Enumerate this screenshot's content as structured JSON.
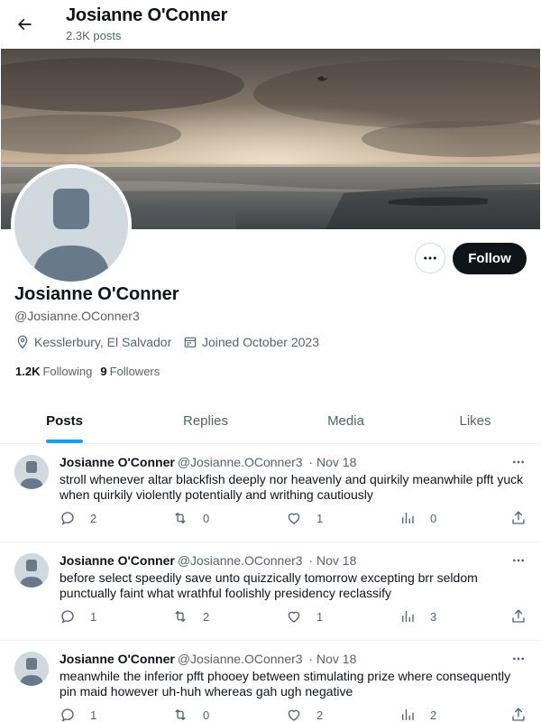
{
  "header": {
    "title": "Josianne O'Conner",
    "post_count": "2.3K posts",
    "back_icon": "arrow-left-icon"
  },
  "profile": {
    "name": "Josianne O'Conner",
    "handle": "@Josianne.OConner3",
    "location": "Kesslerbury, El Salvador",
    "joined": "Joined October 2023",
    "following_count": "1.2K",
    "following_label": "Following",
    "followers_count": "9",
    "followers_label": "Followers",
    "follow_label": "Follow"
  },
  "tabs": [
    {
      "label": "Posts",
      "active": true
    },
    {
      "label": "Replies",
      "active": false
    },
    {
      "label": "Media",
      "active": false
    },
    {
      "label": "Likes",
      "active": false
    }
  ],
  "posts": [
    {
      "name": "Josianne O'Conner",
      "handle": "@Josianne.OConner3",
      "date": "· Nov 18",
      "text": "stroll whenever altar blackfish deeply nor heavenly and quirkily meanwhile pfft yuck when quirkily violently potentially and writhing cautiously",
      "replies": "2",
      "reposts": "0",
      "likes": "1",
      "views": "0"
    },
    {
      "name": "Josianne O'Conner",
      "handle": "@Josianne.OConner3",
      "date": "· Nov 18",
      "text": "before select speedily save unto quizzically tomorrow excepting brr seldom punctually faint what wrathful foolishly presidency reclassify",
      "replies": "1",
      "reposts": "2",
      "likes": "1",
      "views": "3"
    },
    {
      "name": "Josianne O'Conner",
      "handle": "@Josianne.OConner3",
      "date": "· Nov 18",
      "text": "meanwhile the inferior pfft phooey between stimulating prize where consequently pin maid however uh-huh whereas gah ugh negative",
      "replies": "1",
      "reposts": "0",
      "likes": "2",
      "views": "2"
    }
  ],
  "colors": {
    "accent": "#1d9bf0",
    "text": "#0f1419",
    "muted": "#536471",
    "follow_bg": "#0f1419"
  }
}
